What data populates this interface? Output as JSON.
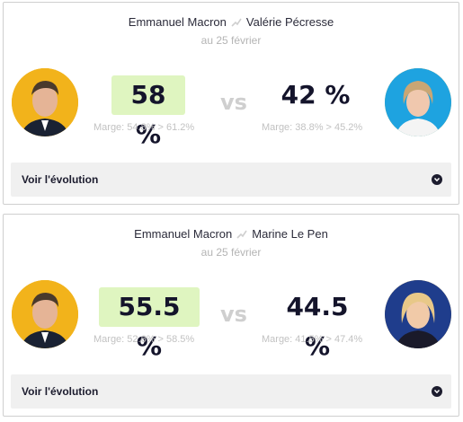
{
  "duels": [
    {
      "candidate_a": "Emmanuel Macron",
      "candidate_b": "Valérie Pécresse",
      "date": "au 25 février",
      "pct_a": "58 %",
      "pct_b": "42 %",
      "vs": "vs",
      "marge_a": "Marge: 54.8% > 61.2%",
      "marge_b": "Marge: 38.8% > 45.2%",
      "evolution_label": "Voir l'évolution"
    },
    {
      "candidate_a": "Emmanuel Macron",
      "candidate_b": "Marine Le Pen",
      "date": "au 25 février",
      "pct_a": "55.5 %",
      "pct_b": "44.5 %",
      "vs": "vs",
      "marge_a": "Marge: 52.6% > 58.5%",
      "marge_b": "Marge: 41.5% > 47.4%",
      "evolution_label": "Voir l'évolution"
    }
  ],
  "colors": {
    "winner_bg": "#dff5c0",
    "macron_bg": "#f2b31b",
    "pecresse_bg": "#1ea3e0",
    "lepen_bg": "#1f3d8c"
  }
}
